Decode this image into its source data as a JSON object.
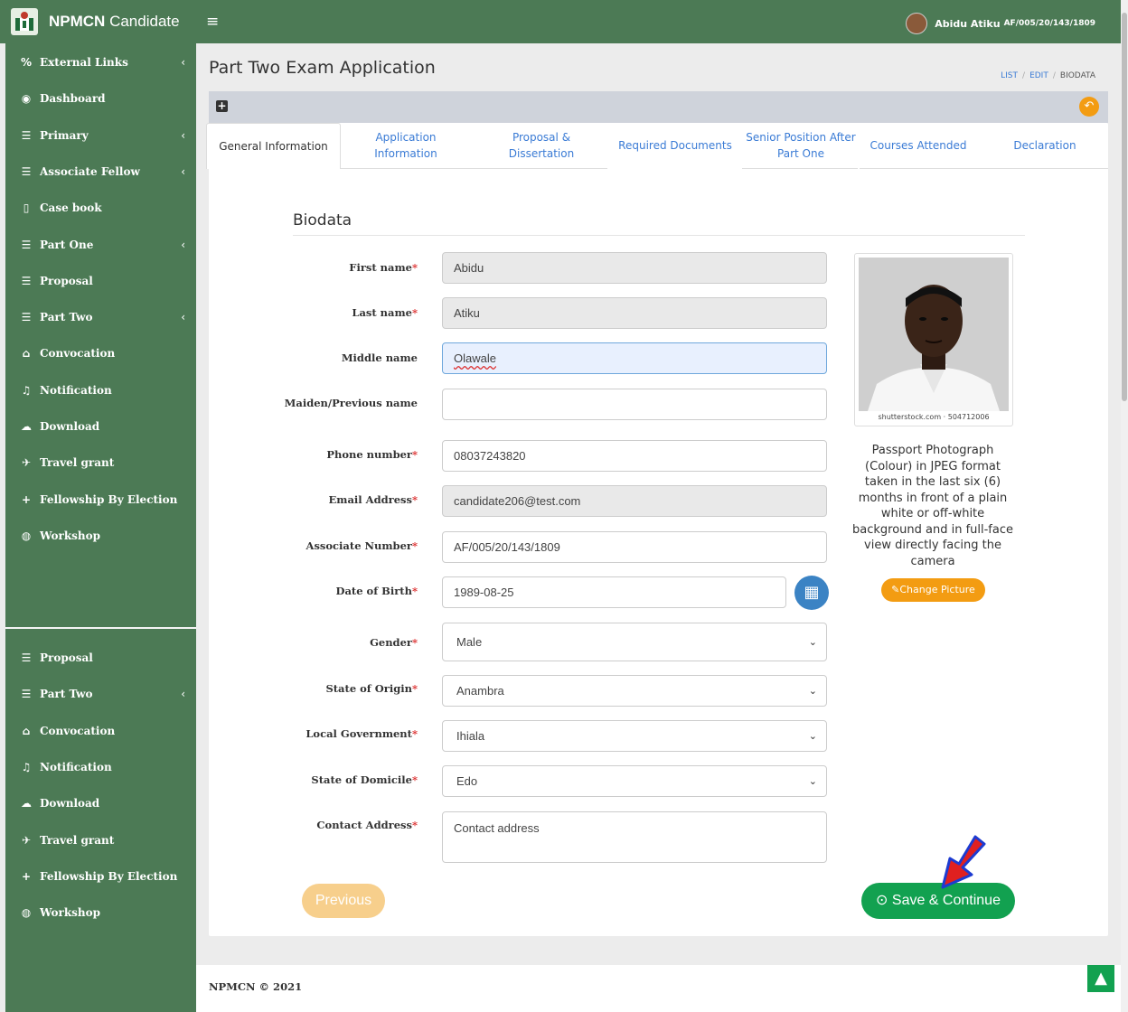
{
  "app": {
    "brand_bold": "NPMCN",
    "brand_rest": "Candidate",
    "menu_icon": "bars-icon"
  },
  "user": {
    "name": "Abidu Atiku",
    "id": "AF/005/20/143/1809"
  },
  "sidebar": {
    "items": [
      {
        "label": "External Links",
        "icon": "link-icon",
        "glyph": "%",
        "chevron": true
      },
      {
        "label": "Dashboard",
        "icon": "dashboard-icon",
        "glyph": "◉",
        "chevron": false
      },
      {
        "label": "Primary",
        "icon": "list-icon",
        "glyph": "☰",
        "chevron": true
      },
      {
        "label": "Associate Fellow",
        "icon": "list-icon",
        "glyph": "☰",
        "chevron": true
      },
      {
        "label": "Case book",
        "icon": "file-icon",
        "glyph": "▯",
        "chevron": false
      },
      {
        "label": "Part One",
        "icon": "list-icon",
        "glyph": "☰",
        "chevron": true
      },
      {
        "label": "Proposal",
        "icon": "list-icon",
        "glyph": "☰",
        "chevron": false
      },
      {
        "label": "Part Two",
        "icon": "list-icon",
        "glyph": "☰",
        "chevron": true
      },
      {
        "label": "Convocation",
        "icon": "graduation-cap-icon",
        "glyph": "⌂",
        "chevron": false
      },
      {
        "label": "Notification",
        "icon": "bell-icon",
        "glyph": "♫",
        "chevron": false
      },
      {
        "label": "Download",
        "icon": "cloud-download-icon",
        "glyph": "☁",
        "chevron": false
      },
      {
        "label": "Travel grant",
        "icon": "plane-icon",
        "glyph": "✈",
        "chevron": false
      },
      {
        "label": "Fellowship By Election",
        "icon": "plus-icon",
        "glyph": "+",
        "chevron": false
      },
      {
        "label": "Workshop",
        "icon": "globe-icon",
        "glyph": "◍",
        "chevron": false
      }
    ],
    "items_lower": [
      {
        "label": "Proposal",
        "icon": "list-icon",
        "glyph": "☰",
        "chevron": false
      },
      {
        "label": "Part Two",
        "icon": "list-icon",
        "glyph": "☰",
        "chevron": true
      },
      {
        "label": "Convocation",
        "icon": "graduation-cap-icon",
        "glyph": "⌂",
        "chevron": false
      },
      {
        "label": "Notification",
        "icon": "bell-icon",
        "glyph": "♫",
        "chevron": false
      },
      {
        "label": "Download",
        "icon": "cloud-download-icon",
        "glyph": "☁",
        "chevron": false
      },
      {
        "label": "Travel grant",
        "icon": "plane-icon",
        "glyph": "✈",
        "chevron": false
      },
      {
        "label": "Fellowship By Election",
        "icon": "plus-icon",
        "glyph": "+",
        "chevron": false
      },
      {
        "label": "Workshop",
        "icon": "globe-icon",
        "glyph": "◍",
        "chevron": false
      }
    ]
  },
  "page": {
    "title": "Part Two Exam Application",
    "breadcrumb": [
      "LIST",
      "EDIT",
      "BIODATA"
    ]
  },
  "tabs": [
    {
      "label": "General Information",
      "active": true
    },
    {
      "label": "Application Information",
      "active": false
    },
    {
      "label": "Proposal & Dissertation",
      "active": false
    },
    {
      "label": "Required Documents",
      "active": false
    },
    {
      "label": "Senior Position After Part One",
      "active": false
    },
    {
      "label": "Courses Attended",
      "active": false
    },
    {
      "label": "Declaration",
      "active": false
    }
  ],
  "form": {
    "section_title": "Biodata",
    "fields": {
      "first_name": {
        "label": "First name",
        "required": true,
        "value": "Abidu"
      },
      "last_name": {
        "label": "Last name",
        "required": true,
        "value": "Atiku"
      },
      "middle_name": {
        "label": "Middle name",
        "required": false,
        "value": "Olawale"
      },
      "maiden_name": {
        "label": "Maiden/Previous name",
        "required": false,
        "value": ""
      },
      "phone": {
        "label": "Phone number",
        "required": true,
        "value": "08037243820"
      },
      "email": {
        "label": "Email Address",
        "required": true,
        "value": "candidate206@test.com"
      },
      "associate_number": {
        "label": "Associate Number",
        "required": true,
        "value": "AF/005/20/143/1809"
      },
      "dob": {
        "label": "Date of Birth",
        "required": true,
        "value": "1989-08-25"
      },
      "gender": {
        "label": "Gender",
        "required": true,
        "value": "Male"
      },
      "state_origin": {
        "label": "State of Origin",
        "required": true,
        "value": "Anambra"
      },
      "lga": {
        "label": "Local Government",
        "required": true,
        "value": "Ihiala"
      },
      "state_domicile": {
        "label": "State of Domicile",
        "required": true,
        "value": "Edo"
      },
      "address": {
        "label": "Contact Address",
        "required": true,
        "placeholder": "Contact address"
      }
    }
  },
  "photo": {
    "caption": "shutterstock.com · 504712006",
    "note": "Passport Photograph (Colour) in JPEG format taken in the last six (6) months in front of a plain white or off-white background and in full-face view directly facing the camera",
    "change_label": "Change Picture"
  },
  "buttons": {
    "previous": "Previous",
    "save": "Save & Continue"
  },
  "footer": {
    "text": "NPMCN © 2021"
  },
  "colors": {
    "sidebar": "#4c7a55",
    "save": "#12a150",
    "accent_orange": "#f39c12",
    "link": "#3a7bd5"
  }
}
